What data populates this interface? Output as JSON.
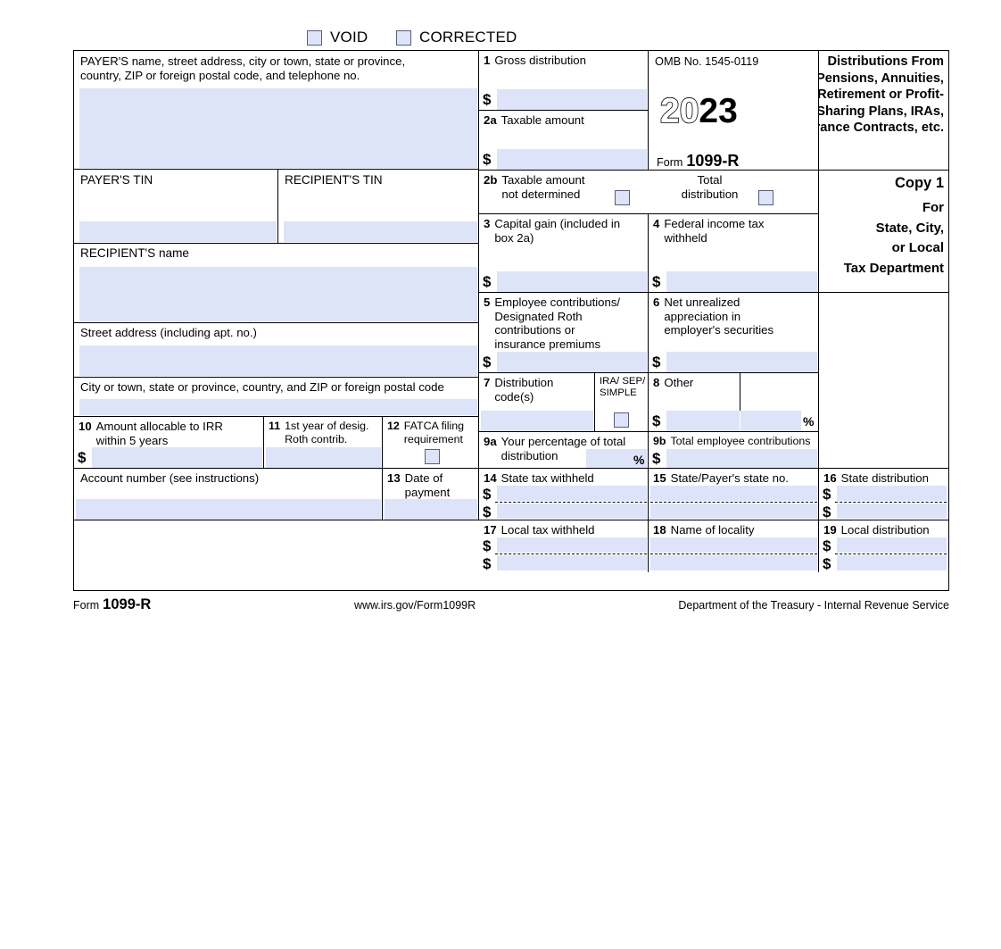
{
  "top_checkboxes": [
    {
      "name": "void",
      "label": "VOID",
      "checked": false
    },
    {
      "name": "corrected",
      "label": "CORRECTED",
      "checked": false
    }
  ],
  "payer": {
    "block_label": "PAYER'S name, street address, city or town, state or province,\ncountry, ZIP or foreign postal code, and telephone no.",
    "value": "",
    "tin_label": "PAYER'S TIN",
    "tin_value": ""
  },
  "recipient": {
    "tin_label": "RECIPIENT'S TIN",
    "tin_value": "",
    "name_label": "RECIPIENT'S name",
    "name_value": "",
    "street_label": "Street address (including apt. no.)",
    "street_value": "",
    "city_label": "City or town, state or province, country, and ZIP or foreign postal code",
    "city_value": ""
  },
  "omb": {
    "number_label": "OMB No. 1545-0119",
    "year_prefix": "20",
    "year_suffix": "23",
    "form_word": "Form",
    "form_number": "1099-R"
  },
  "header_right": {
    "title": "Distributions From\nPensions, Annuities,\nRetirement or\nProfit-Sharing Plans,\nIRAs, Insurance\nContracts, etc.",
    "copy_label": "Copy 1",
    "copy_for": "For\nState, City,\nor Local\nTax Department"
  },
  "boxes": {
    "b1": {
      "num": "1",
      "label": "Gross distribution",
      "currency": "$",
      "value": ""
    },
    "b2a": {
      "num": "2a",
      "label": "Taxable amount",
      "currency": "$",
      "value": ""
    },
    "b2b": {
      "num": "2b",
      "label": "Taxable amount\nnot determined",
      "checked": false
    },
    "total_distribution": {
      "label": "Total\ndistribution",
      "checked": false
    },
    "b3": {
      "num": "3",
      "label": "Capital gain (included in\nbox 2a)",
      "currency": "$",
      "value": ""
    },
    "b4": {
      "num": "4",
      "label": "Federal income tax\nwithheld",
      "currency": "$",
      "value": ""
    },
    "b5": {
      "num": "5",
      "label": "Employee contributions/\nDesignated Roth\ncontributions or\ninsurance premiums",
      "currency": "$",
      "value": ""
    },
    "b6": {
      "num": "6",
      "label": "Net unrealized\nappreciation in\nemployer's securities",
      "currency": "$",
      "value": ""
    },
    "b7": {
      "num": "7",
      "label": "Distribution\ncode(s)",
      "value": ""
    },
    "ira_sep_simple": {
      "label": "IRA/\nSEP/\nSIMPLE",
      "checked": false
    },
    "b8": {
      "num": "8",
      "label": "Other",
      "currency": "$",
      "value": "",
      "percent_symbol": "%",
      "percent_value": ""
    },
    "b9a": {
      "num": "9a",
      "label": "Your percentage of total\ndistribution",
      "percent_symbol": "%",
      "value": ""
    },
    "b9b": {
      "num": "9b",
      "label": "Total employee contributions",
      "currency": "$",
      "value": ""
    },
    "b10": {
      "num": "10",
      "label": "Amount allocable to IRR\nwithin 5 years",
      "currency": "$",
      "value": ""
    },
    "b11": {
      "num": "11",
      "label": "1st year of desig.\nRoth contrib.",
      "value": ""
    },
    "b12": {
      "num": "12",
      "label": "FATCA filing\nrequirement",
      "checked": false
    },
    "b13": {
      "num": "13",
      "label": "Date of\npayment",
      "value": ""
    },
    "b14": {
      "num": "14",
      "label": "State tax withheld",
      "currency": "$",
      "row1_value": "",
      "row2_value": ""
    },
    "b15": {
      "num": "15",
      "label": "State/Payer's state no.",
      "row1_value": "",
      "row2_value": ""
    },
    "b16": {
      "num": "16",
      "label": "State distribution",
      "currency": "$",
      "row1_value": "",
      "row2_value": ""
    },
    "b17": {
      "num": "17",
      "label": "Local tax withheld",
      "currency": "$",
      "row1_value": "",
      "row2_value": ""
    },
    "b18": {
      "num": "18",
      "label": "Name of locality",
      "row1_value": "",
      "row2_value": ""
    },
    "b19": {
      "num": "19",
      "label": "Local distribution",
      "currency": "$",
      "row1_value": "",
      "row2_value": ""
    },
    "account": {
      "label": "Account number (see instructions)",
      "value": ""
    }
  },
  "footer": {
    "form_word": "Form",
    "form_number": "1099-R",
    "url": "www.irs.gov/Form1099R",
    "agency": "Department of the Treasury - Internal Revenue Service"
  },
  "colors": {
    "field_fill": "#dde3f8",
    "checkbox_border": "#5a5f78",
    "rule": "#000000"
  }
}
